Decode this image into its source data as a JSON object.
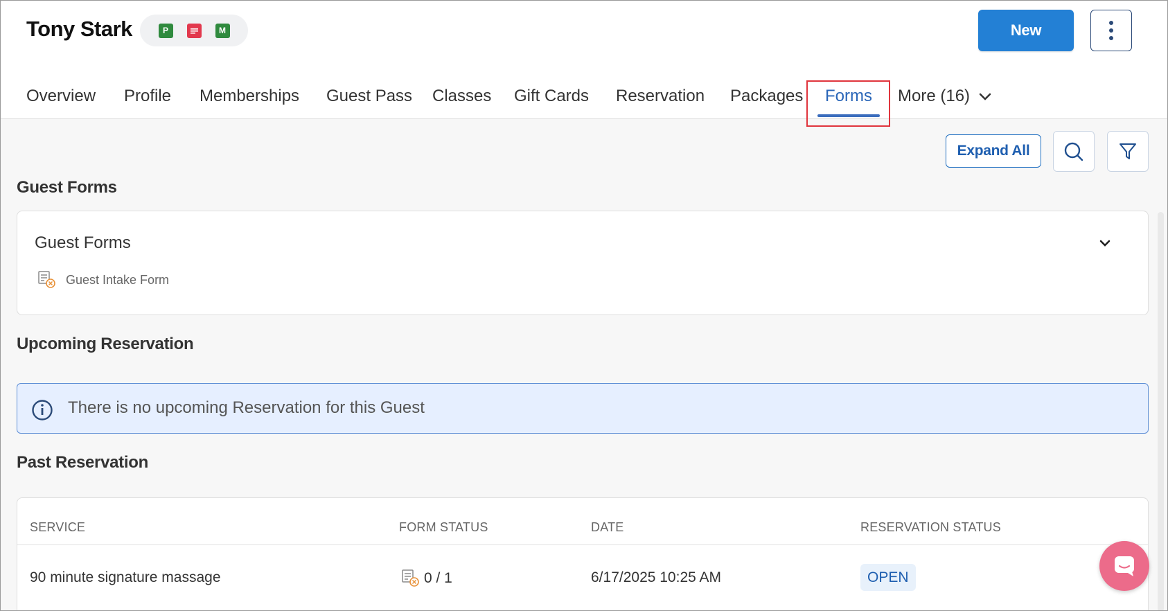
{
  "guest": {
    "name": "Tony Stark",
    "badges": [
      {
        "letter": "P",
        "color": "#2f8a3e"
      },
      {
        "icon": "message-icon",
        "color": "#e2384d"
      },
      {
        "letter": "M",
        "color": "#2f8a3e"
      }
    ]
  },
  "header": {
    "new_label": "New",
    "more_icon": "vertical-dots-icon"
  },
  "tabs": [
    {
      "label": "Overview"
    },
    {
      "label": "Profile"
    },
    {
      "label": "Memberships"
    },
    {
      "label": "Guest Pass"
    },
    {
      "label": "Classes"
    },
    {
      "label": "Gift Cards"
    },
    {
      "label": "Reservation"
    },
    {
      "label": "Packages"
    },
    {
      "label": "Forms",
      "active": true
    },
    {
      "label": "More (16)"
    }
  ],
  "toolbar": {
    "expand_all_label": "Expand All",
    "search_icon": "search-icon",
    "filter_icon": "filter-icon"
  },
  "guest_forms": {
    "section_title": "Guest Forms",
    "card_title": "Guest Forms",
    "items": [
      {
        "label": "Guest Intake Form",
        "icon": "form-incomplete-icon"
      }
    ]
  },
  "upcoming": {
    "section_title": "Upcoming Reservation",
    "message": "There is no upcoming Reservation for this Guest"
  },
  "past": {
    "section_title": "Past Reservation",
    "columns": [
      "SERVICE",
      "FORM STATUS",
      "DATE",
      "RESERVATION STATUS"
    ],
    "rows": [
      {
        "service": "90 minute signature massage",
        "form_status": "0 / 1",
        "date": "6/17/2025 10:25 AM",
        "reservation_status": "OPEN"
      }
    ]
  },
  "colors": {
    "primary": "#2380d5",
    "active_tab": "#2a66b8",
    "highlight": "#e0353d",
    "chat": "#ec6b8a"
  }
}
